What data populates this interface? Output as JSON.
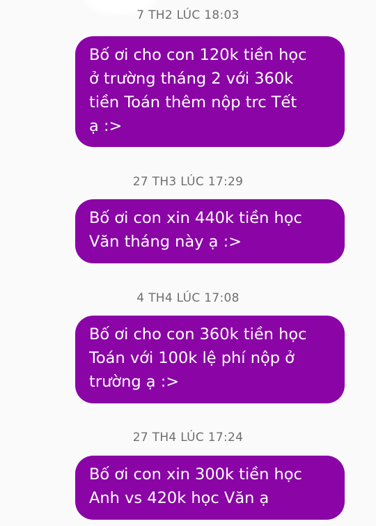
{
  "theme": {
    "bubble_color": "#8a04a6",
    "timestamp_color": "#6f6f6f",
    "background": "#fafafa"
  },
  "messages": [
    {
      "timestamp": "7 TH2 LÚC 18:03",
      "text": "Bố ơi cho con 120k tiền học\nở trường tháng 2 với 360k\ntiền Toán thêm nộp trc Tết\nạ :>"
    },
    {
      "timestamp": "27 TH3 LÚC 17:29",
      "text": "Bố ơi con xin 440k tiền học\nVăn tháng này ạ :>"
    },
    {
      "timestamp": "4 TH4 LÚC 17:08",
      "text": "Bố ơi cho con 360k tiền học\nToán với 100k lệ phí nộp ở\ntrường ạ :>"
    },
    {
      "timestamp": "27 TH4 LÚC 17:24",
      "text": "Bố ơi con xin 300k tiền học\nAnh vs 420k học Văn ạ"
    }
  ]
}
